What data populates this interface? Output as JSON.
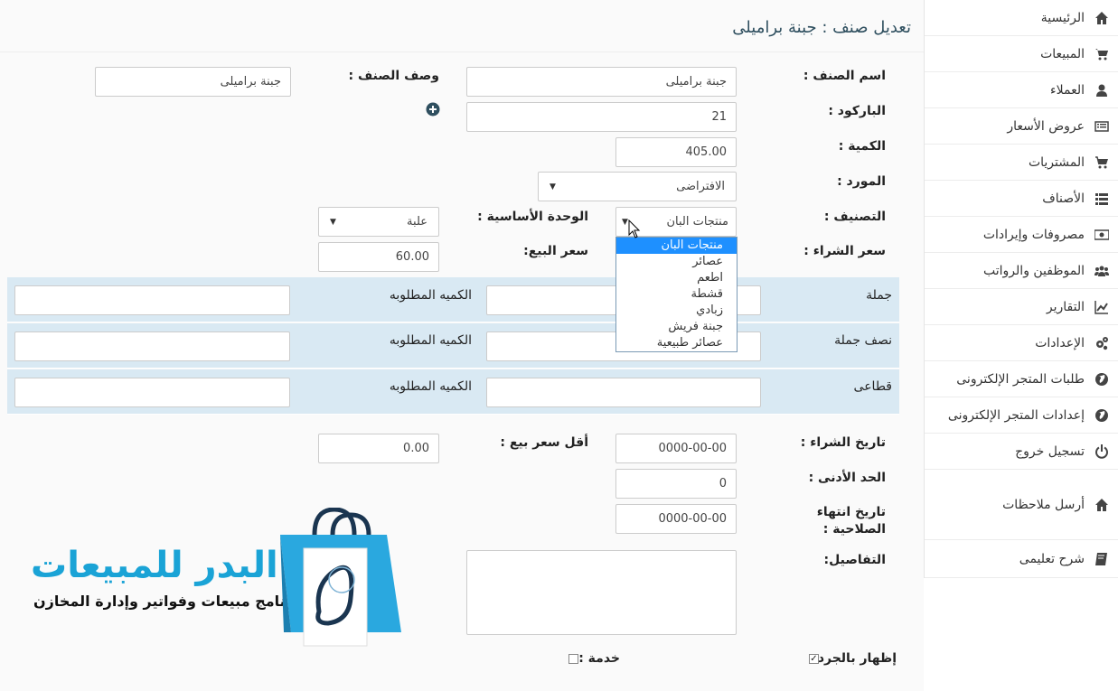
{
  "sidebar": {
    "items": [
      {
        "label": "الرئيسية",
        "icon": "home-icon"
      },
      {
        "label": "المبيعات",
        "icon": "cart-icon"
      },
      {
        "label": "العملاء",
        "icon": "user-icon"
      },
      {
        "label": "عروض الأسعار",
        "icon": "list-icon"
      },
      {
        "label": "المشتريات",
        "icon": "cart-plus-icon"
      },
      {
        "label": "الأصناف",
        "icon": "bullet-list-icon"
      },
      {
        "label": "مصروفات وإيرادات",
        "icon": "money-icon"
      },
      {
        "label": "الموظفين والرواتب",
        "icon": "users-icon"
      },
      {
        "label": "التقارير",
        "icon": "chart-icon"
      },
      {
        "label": "الإعدادات",
        "icon": "gears-icon"
      },
      {
        "label": "طلبات المتجر الإلكترونى",
        "icon": "globe-icon"
      },
      {
        "label": "إعدادات المتجر الإلكترونى",
        "icon": "globe-icon"
      },
      {
        "label": "تسجيل خروج",
        "icon": "power-icon"
      },
      {
        "label": "أرسل ملاحظات",
        "icon": "home-icon"
      },
      {
        "label": "شرح تعليمى",
        "icon": "book-icon"
      }
    ]
  },
  "page": {
    "title": "تعديل صنف : جبنة براميلى"
  },
  "form": {
    "item_name_label": "اسم الصنف :",
    "item_name_value": "جبنة براميلى",
    "item_desc_label": "وصف الصنف :",
    "item_desc_value": "جبنة براميلى",
    "barcode_label": "الباركود :",
    "barcode_value": "21",
    "quantity_label": "الكمية :",
    "quantity_value": "405.00",
    "supplier_label": "المورد :",
    "supplier_value": "الافتراضى",
    "category_label": "التصنيف :",
    "category_value": "منتجات البان",
    "unit_label": "الوحدة الأساسية :",
    "unit_value": "علبة",
    "purchase_price_label": "سعر الشراء :",
    "sale_price_label": "سعر البيع:",
    "sale_price_value": "60.00",
    "purchase_date_label": "تاريخ الشراء :",
    "purchase_date_value": "0000-00-00",
    "min_sale_price_label": "أقل سعر بيع :",
    "min_sale_price_value": "0.00",
    "min_limit_label": "الحد الأدنى :",
    "min_limit_value": "0",
    "expiry_label_line1": "تاريخ انتهاء",
    "expiry_label_line2": "الصلاحية :",
    "expiry_value": "0000-00-00",
    "details_label": "التفاصيل:",
    "inventory_label": "إظهار بالجرد :",
    "service_label": "خدمة :"
  },
  "bands": [
    {
      "label": "جملة",
      "qty_label": "الكميه المطلوبه"
    },
    {
      "label": "نصف جملة",
      "qty_label": "الكميه المطلوبه"
    },
    {
      "label": "قطاعى",
      "qty_label": "الكميه المطلوبه"
    }
  ],
  "dropdown": {
    "options": [
      "منتجات البان",
      "عصائر",
      "اطعم",
      "قشطة",
      "زبادي",
      "جبنة فريش",
      "عصائر طبيعية"
    ]
  },
  "logo": {
    "title": "البدر للمبيعات",
    "subtitle": "برنامج مبيعات وفواتير وإدارة المخازن"
  },
  "colors": {
    "accent": "#1aa3d6",
    "band": "#d9e9f3",
    "selected": "#1e90ff"
  }
}
